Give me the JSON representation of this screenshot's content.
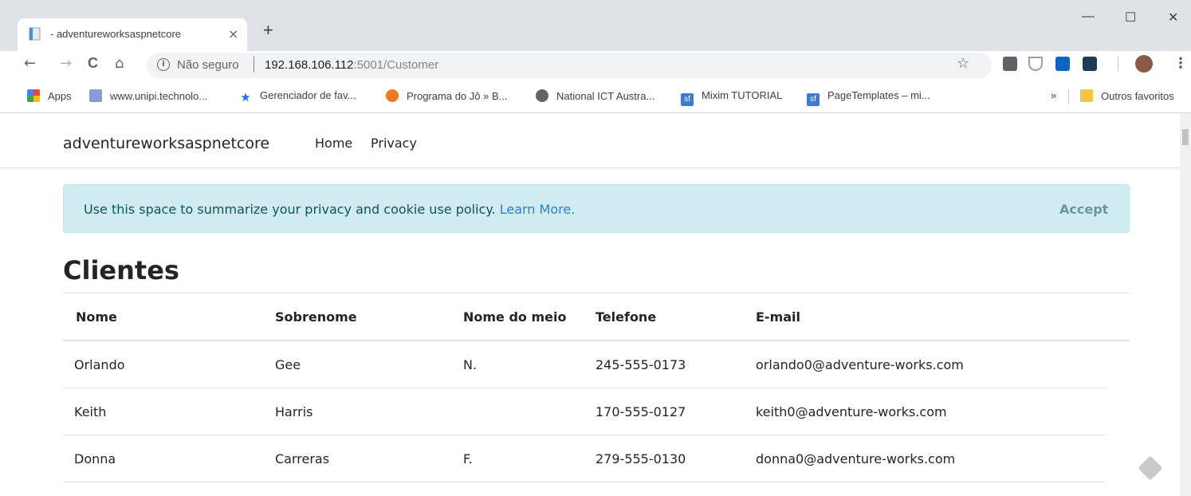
{
  "browser": {
    "tab_title": "- adventureworksaspnetcore",
    "tab_close": "×",
    "new_tab": "+",
    "win_minimize": "—",
    "win_maximize": "☐",
    "win_close": "✕",
    "nav_back": "←",
    "nav_forward": "→",
    "nav_reload": "C",
    "nav_home": "⌂",
    "security_label": "Não seguro",
    "url_host": "192.168.106.112",
    "url_path": ":5001/Customer",
    "bookmarks": [
      {
        "label": "Apps",
        "icon": "apps-grid-icon",
        "color": "#e8453c"
      },
      {
        "label": "www.unipi.technolo...",
        "icon": "unipi-icon",
        "color": "#5b8ac9"
      },
      {
        "label": "Gerenciador de fav...",
        "icon": "star-icon",
        "color": "#1a73e8"
      },
      {
        "label": "Programa do Jô » B...",
        "icon": "globo-icon",
        "color": "#f07a1e"
      },
      {
        "label": "National ICT Austra...",
        "icon": "globe-icon",
        "color": "#5f6368"
      },
      {
        "label": "Mixim TUTORIAL",
        "icon": "sf-icon",
        "color": "#3a7bd5"
      },
      {
        "label": "PageTemplates – mi...",
        "icon": "sf-icon",
        "color": "#3a7bd5"
      }
    ],
    "bookmarks_more": "»",
    "other_bookmarks": "Outros favoritos"
  },
  "app": {
    "brand": "adventureworksaspnetcore",
    "nav": [
      "Home",
      "Privacy"
    ]
  },
  "cookie_alert": {
    "text": "Use this space to summarize your privacy and cookie use policy.",
    "link": "Learn More.",
    "accept": "Accept"
  },
  "page_title": "Clientes",
  "table": {
    "headers": [
      "Nome",
      "Sobrenome",
      "Nome do meio",
      "Telefone",
      "E-mail"
    ],
    "rows": [
      [
        "Orlando",
        "Gee",
        "N.",
        "245-555-0173",
        "orlando0@adventure-works.com"
      ],
      [
        "Keith",
        "Harris",
        "",
        "170-555-0127",
        "keith0@adventure-works.com"
      ],
      [
        "Donna",
        "Carreras",
        "F.",
        "279-555-0130",
        "donna0@adventure-works.com"
      ]
    ]
  }
}
